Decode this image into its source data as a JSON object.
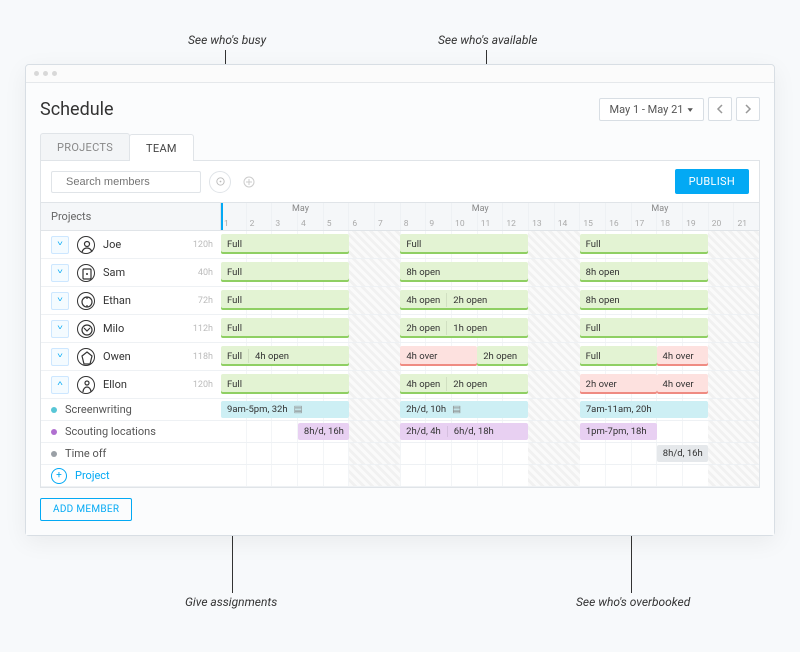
{
  "page": {
    "title": "Schedule"
  },
  "annotations": {
    "busy": "See who's busy",
    "available": "See who's available",
    "assignments": "Give assignments",
    "overbooked": "See who's overbooked"
  },
  "dateRange": {
    "label": "May 1 - May 21"
  },
  "tabs": {
    "projects": "PROJECTS",
    "team": "TEAM"
  },
  "search": {
    "placeholder": "Search members"
  },
  "publish": {
    "label": "PUBLISH"
  },
  "gridHeader": {
    "projects": "Projects",
    "month": "May"
  },
  "days": [
    "1",
    "2",
    "3",
    "4",
    "5",
    "6",
    "7",
    "8",
    "9",
    "10",
    "11",
    "12",
    "13",
    "14",
    "15",
    "16",
    "17",
    "18",
    "19",
    "20",
    "21"
  ],
  "members": [
    {
      "name": "Joe",
      "hours": "120h"
    },
    {
      "name": "Sam",
      "hours": "40h"
    },
    {
      "name": "Ethan",
      "hours": "72h"
    },
    {
      "name": "Milo",
      "hours": "112h"
    },
    {
      "name": "Owen",
      "hours": "118h"
    },
    {
      "name": "Ellon",
      "hours": "120h"
    }
  ],
  "labels": {
    "full": "Full",
    "open8": "8h open",
    "open4": "4h open",
    "open2": "2h open",
    "open1": "1h open",
    "over4": "4h over",
    "over2": "2h over"
  },
  "tasks": {
    "screenwriting": {
      "name": "Screenwriting",
      "a": "9am-5pm, 32h",
      "b": "2h/d, 10h",
      "c": "7am-11am, 20h"
    },
    "scouting": {
      "name": "Scouting locations",
      "a": "8h/d, 16h",
      "b1": "2h/d, 4h",
      "b2": "6h/d, 18h",
      "c": "1pm-7pm, 18h"
    },
    "timeoff": {
      "name": "Time off",
      "a": "8h/d, 16h"
    }
  },
  "addProject": {
    "label": "Project"
  },
  "addMember": {
    "label": "ADD MEMBER"
  },
  "chart_data": {
    "type": "table",
    "title": "Team schedule May 1–21",
    "columns_days": [
      1,
      2,
      3,
      4,
      5,
      6,
      7,
      8,
      9,
      10,
      11,
      12,
      13,
      14,
      15,
      16,
      17,
      18,
      19,
      20,
      21
    ],
    "weekends": [
      [
        6,
        7
      ],
      [
        13,
        14
      ],
      [
        20,
        21
      ]
    ],
    "members": [
      {
        "name": "Joe",
        "total_hours": 120,
        "weeks": [
          {
            "days": [
              1,
              5
            ],
            "status": "full"
          },
          {
            "days": [
              8,
              12
            ],
            "status": "full"
          },
          {
            "days": [
              15,
              19
            ],
            "status": "full"
          }
        ]
      },
      {
        "name": "Sam",
        "total_hours": 40,
        "weeks": [
          {
            "days": [
              1,
              5
            ],
            "status": "full"
          },
          {
            "days": [
              8,
              12
            ],
            "status": "open",
            "open_h": 8
          },
          {
            "days": [
              15,
              19
            ],
            "status": "open",
            "open_h": 8
          }
        ]
      },
      {
        "name": "Ethan",
        "total_hours": 72,
        "weeks": [
          {
            "days": [
              1,
              5
            ],
            "status": "full"
          },
          {
            "days": [
              8,
              10
            ],
            "status": "open",
            "open_h": 4
          },
          {
            "days": [
              11,
              12
            ],
            "status": "open",
            "open_h": 2
          },
          {
            "days": [
              15,
              19
            ],
            "status": "open",
            "open_h": 8
          }
        ]
      },
      {
        "name": "Milo",
        "total_hours": 112,
        "weeks": [
          {
            "days": [
              1,
              5
            ],
            "status": "full"
          },
          {
            "days": [
              8,
              10
            ],
            "status": "open",
            "open_h": 2
          },
          {
            "days": [
              11,
              12
            ],
            "status": "open",
            "open_h": 1
          },
          {
            "days": [
              15,
              19
            ],
            "status": "full"
          }
        ]
      },
      {
        "name": "Owen",
        "total_hours": 118,
        "weeks": [
          {
            "days": [
              1,
              3
            ],
            "status": "full"
          },
          {
            "days": [
              4,
              5
            ],
            "status": "open",
            "open_h": 4
          },
          {
            "days": [
              8,
              10
            ],
            "status": "over",
            "over_h": 4
          },
          {
            "days": [
              11,
              12
            ],
            "status": "open",
            "open_h": 2
          },
          {
            "days": [
              15,
              17
            ],
            "status": "full"
          },
          {
            "days": [
              18,
              19
            ],
            "status": "over",
            "over_h": 4
          }
        ]
      },
      {
        "name": "Ellon",
        "total_hours": 120,
        "weeks": [
          {
            "days": [
              1,
              5
            ],
            "status": "full"
          },
          {
            "days": [
              8,
              10
            ],
            "status": "open",
            "open_h": 4
          },
          {
            "days": [
              11,
              12
            ],
            "status": "open",
            "open_h": 2
          },
          {
            "days": [
              15,
              17
            ],
            "status": "over",
            "over_h": 2
          },
          {
            "days": [
              18,
              19
            ],
            "status": "over",
            "over_h": 4
          }
        ]
      }
    ],
    "assignments_for_ellon": [
      {
        "project": "Screenwriting",
        "color": "#58c6d6",
        "segments": [
          {
            "days": [
              1,
              5
            ],
            "label": "9am-5pm",
            "hours": 32
          },
          {
            "days": [
              8,
              12
            ],
            "label": "2h/d",
            "hours": 10
          },
          {
            "days": [
              15,
              19
            ],
            "label": "7am-11am",
            "hours": 20
          }
        ]
      },
      {
        "project": "Scouting locations",
        "color": "#b06fd0",
        "segments": [
          {
            "days": [
              4,
              5
            ],
            "label": "8h/d",
            "hours": 16
          },
          {
            "days": [
              8,
              9
            ],
            "label": "2h/d",
            "hours": 4
          },
          {
            "days": [
              10,
              12
            ],
            "label": "6h/d",
            "hours": 18
          },
          {
            "days": [
              15,
              17
            ],
            "label": "1pm-7pm",
            "hours": 18
          }
        ]
      },
      {
        "project": "Time off",
        "color": "#9aa0a6",
        "segments": [
          {
            "days": [
              18,
              19
            ],
            "label": "8h/d",
            "hours": 16
          }
        ]
      }
    ]
  }
}
